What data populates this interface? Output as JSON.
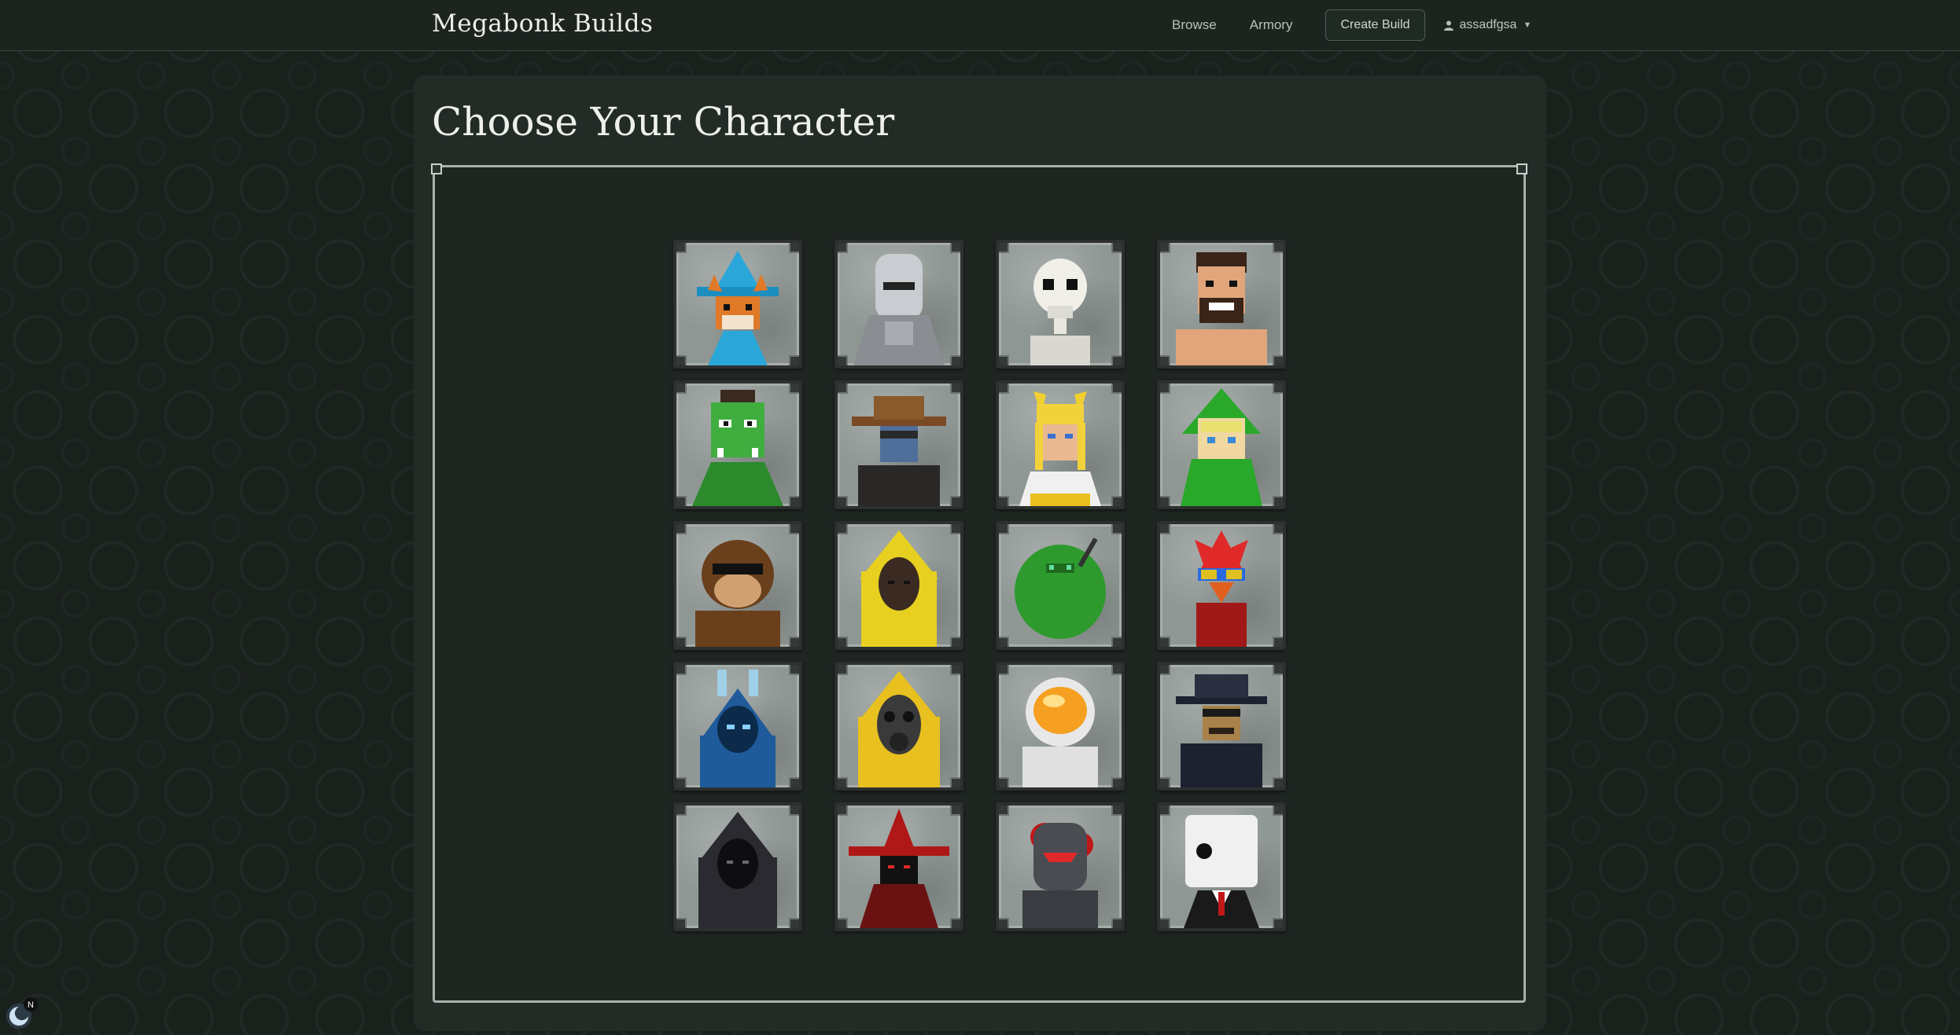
{
  "brand": "Megabonk Builds",
  "nav": {
    "browse": "Browse",
    "armory": "Armory",
    "create_build": "Create Build",
    "user": "assadfgsa"
  },
  "page_title": "Choose Your Character",
  "characters": [
    {
      "portrait": "fox-wizard"
    },
    {
      "portrait": "armored-knight"
    },
    {
      "portrait": "skeleton"
    },
    {
      "portrait": "bearded-muscleman"
    },
    {
      "portrait": "green-orc"
    },
    {
      "portrait": "cowboy"
    },
    {
      "portrait": "valkyrie"
    },
    {
      "portrait": "green-hooded-elf"
    },
    {
      "portrait": "sunglasses-monkey"
    },
    {
      "portrait": "yellow-hooded-figure"
    },
    {
      "portrait": "green-bush"
    },
    {
      "portrait": "red-bird"
    },
    {
      "portrait": "blue-bunny-hood"
    },
    {
      "portrait": "gas-mask-hazmat"
    },
    {
      "portrait": "astronaut"
    },
    {
      "portrait": "fedora-detective"
    },
    {
      "portrait": "dark-hooded-figure"
    },
    {
      "portrait": "red-hat-mage"
    },
    {
      "portrait": "red-visor-knight"
    },
    {
      "portrait": "dice-head-suit"
    }
  ],
  "colors": {
    "background": "#1a211d",
    "panel": "#232b27",
    "card_stone": "#8f9794"
  }
}
